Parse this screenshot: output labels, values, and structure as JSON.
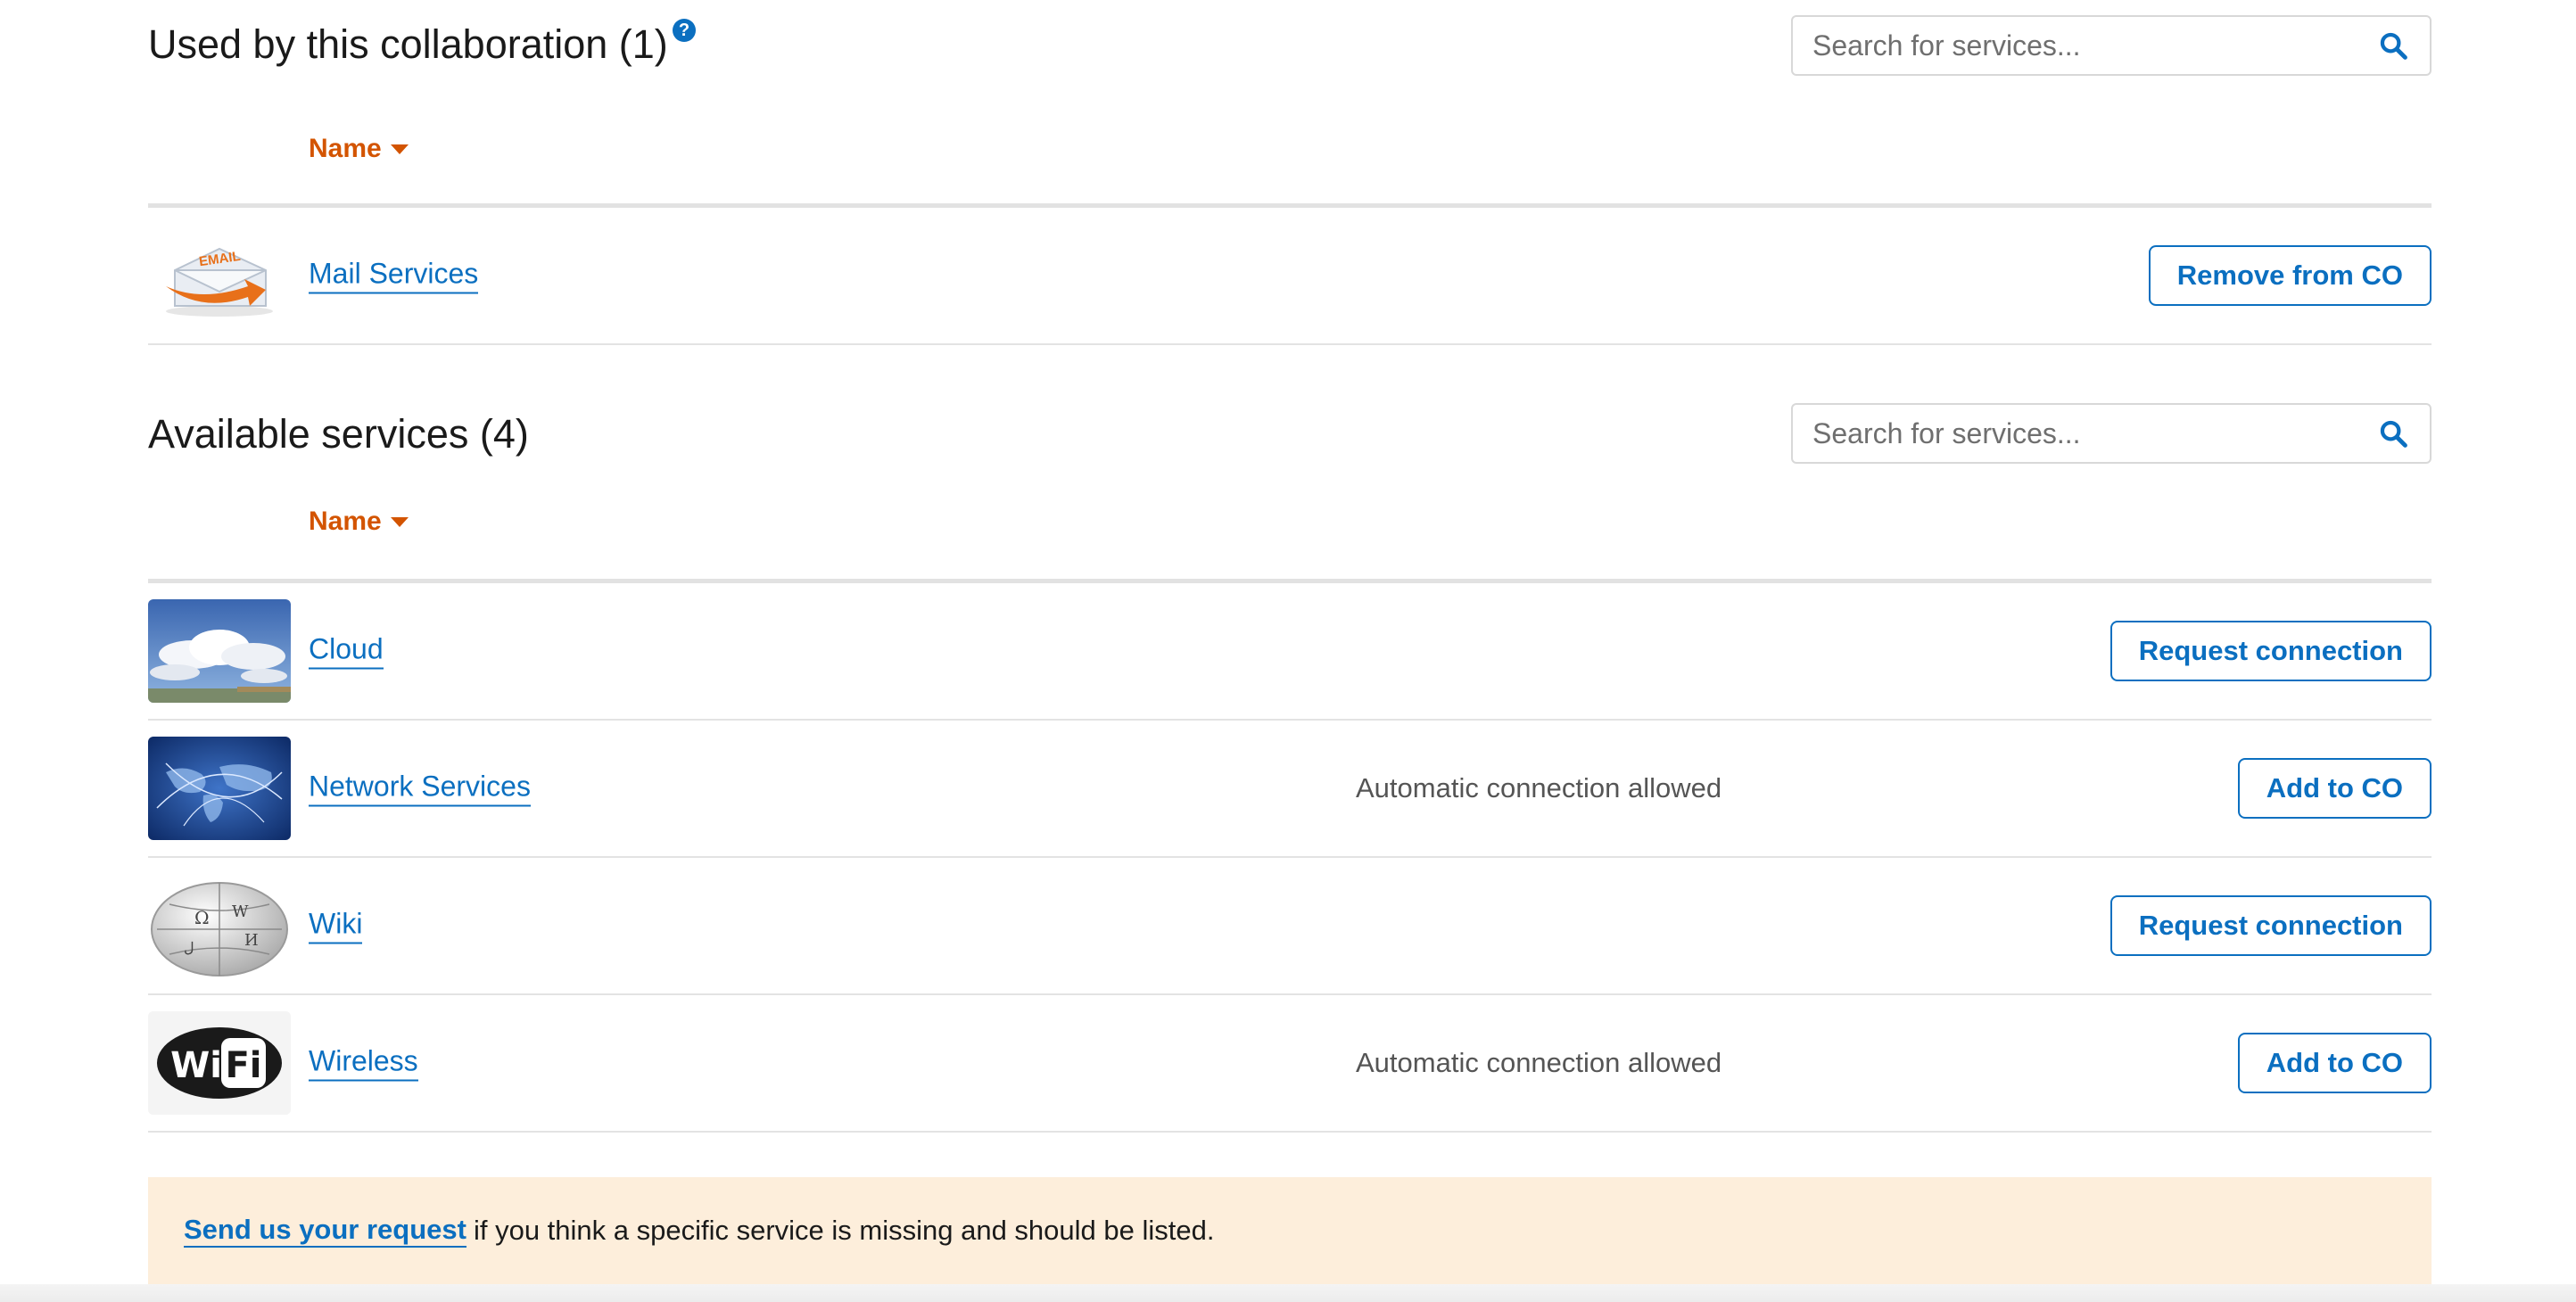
{
  "used_section": {
    "title": "Used by this collaboration (1)",
    "search_placeholder": "Search for services...",
    "sort_label": "Name",
    "rows": [
      {
        "name": "Mail Services",
        "note": "",
        "action": "Remove from CO",
        "icon": "email-icon"
      }
    ]
  },
  "available_section": {
    "title": "Available services (4)",
    "search_placeholder": "Search for services...",
    "sort_label": "Name",
    "rows": [
      {
        "name": "Cloud",
        "note": "",
        "action": "Request connection",
        "icon": "cloud-photo"
      },
      {
        "name": "Network Services",
        "note": "Automatic connection allowed",
        "action": "Add to CO",
        "icon": "world-network-image"
      },
      {
        "name": "Wiki",
        "note": "",
        "action": "Request connection",
        "icon": "wikipedia-globe-logo"
      },
      {
        "name": "Wireless",
        "note": "Automatic connection allowed",
        "action": "Add to CO",
        "icon": "wifi-logo"
      }
    ]
  },
  "notice": {
    "link_text": "Send us your request",
    "text": "if you think a specific service is missing and should be listed."
  },
  "colors": {
    "link": "#0b6fc0",
    "sort": "#d35400",
    "notice_bg": "#fdeedb"
  }
}
